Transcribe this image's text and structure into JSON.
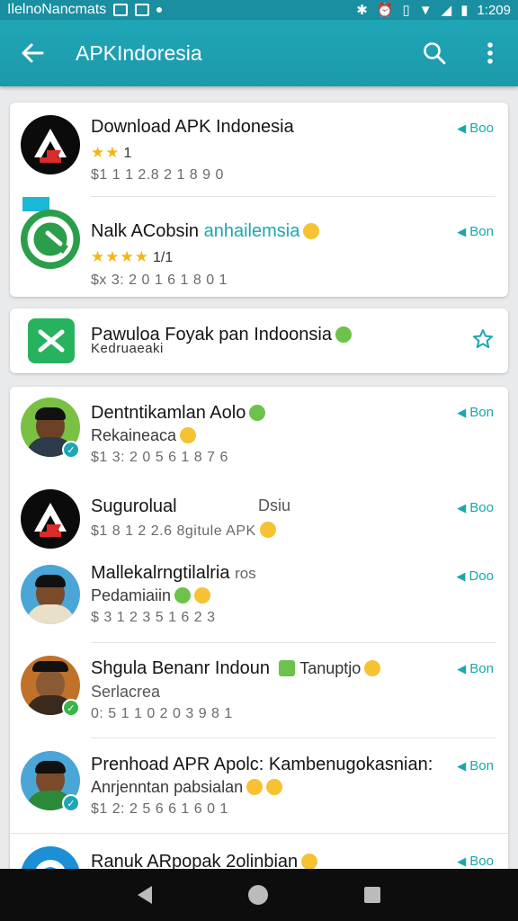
{
  "status_bar": {
    "left_text": "IlelnoNancmats",
    "time": "1:209",
    "icons": [
      "image-icon",
      "gallery-icon",
      "dot-icon",
      "bluetooth-icon",
      "alarm-icon",
      "vibrate-icon",
      "wifi-icon",
      "signal-icon",
      "battery-icon"
    ]
  },
  "app_bar": {
    "title": "APKIndoresia",
    "back_icon": "arrow-back-icon",
    "search_icon": "search-icon",
    "menu_icon": "more-vert-icon",
    "color": "#1fa6b6"
  },
  "card1": {
    "items": [
      {
        "name": "Download APK Indonesia",
        "stars": "★★",
        "rating": "1",
        "meta": "$1 1 1   2.8 2   1 8 9 0",
        "button": "Boo"
      },
      {
        "name": "Nalk ACobsin ",
        "name_highlight": "anhailemsia",
        "stars": "★★★★",
        "rating": "1/1",
        "meta": "$x 3:   2 0 1 6   1 8 0 1",
        "button": "Bon"
      }
    ]
  },
  "card2": {
    "name": "Pawuloa Foyak pan Indoonsia",
    "sub": "Kedruaeaki",
    "star_icon": "star-outline-icon"
  },
  "card3": {
    "items": [
      {
        "name": "Dentntikamlan Aolo",
        "sub": "Rekaineaca",
        "meta": "$1 3:   2 0 5 6   1 8 7 6",
        "button": "Bon"
      },
      {
        "name": "Sugurolual",
        "name_right": "Dsiu",
        "meta": "$1 8 1   2 2.6   8gitule APK",
        "button": "Boo"
      },
      {
        "name": "Mallekalrngtilalria",
        "name_suffix": "ros",
        "sub": "Pedamiaiin",
        "meta": "$ 3 1   2 3 5   1 6 2 3",
        "button": "Doo"
      },
      {
        "name": "Shgula Benanr Indoun",
        "name_suffix": "Tanuptjo",
        "sub": "Serlacrea",
        "meta": "0: 5 1   1 0 2 0   3 9 8 1",
        "button": "Bon"
      },
      {
        "name": "Prenhoad APR Apolc: Kambenugokasnian:",
        "sub": "Anrjenntan pabsialan",
        "meta": "$1 2:   2 5 6 6   1 6 0 1",
        "button": "Bon"
      },
      {
        "name": "Ranuk ARpopak 2olinbian",
        "button": "Boo"
      }
    ]
  },
  "nav_bar": {
    "back": "nav-back-icon",
    "home": "nav-home-icon",
    "recents": "nav-recents-icon"
  }
}
